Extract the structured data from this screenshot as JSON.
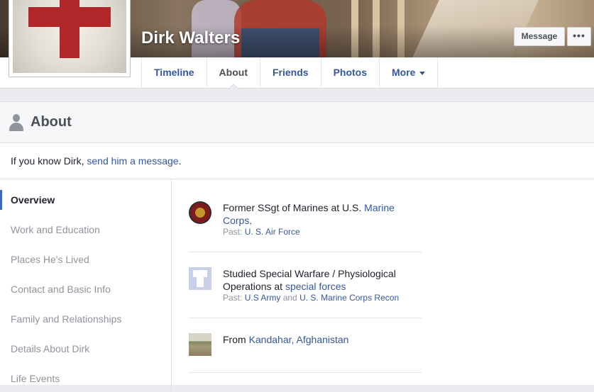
{
  "profile": {
    "name": "Dirk Walters"
  },
  "actions": {
    "message_label": "Message",
    "more_label": "•••"
  },
  "tabs": [
    {
      "label": "Timeline"
    },
    {
      "label": "About"
    },
    {
      "label": "Friends"
    },
    {
      "label": "Photos"
    },
    {
      "label": "More"
    }
  ],
  "about": {
    "title": "About",
    "intro_prefix": "If you know Dirk, ",
    "intro_link": "send him a message",
    "intro_suffix": "."
  },
  "sidenav": [
    {
      "label": "Overview"
    },
    {
      "label": "Work and Education"
    },
    {
      "label": "Places He's Lived"
    },
    {
      "label": "Contact and Basic Info"
    },
    {
      "label": "Family and Relationships"
    },
    {
      "label": "Details About Dirk"
    },
    {
      "label": "Life Events"
    }
  ],
  "entries": {
    "work": {
      "text_prefix": "Former SSgt of Marines at U.S. ",
      "link": "Marine Corps",
      "text_suffix": ".",
      "past_prefix": "Past: ",
      "past_link": "U. S. Air Force"
    },
    "education": {
      "text_prefix": "Studied Special Warfare / Physiological Operations at ",
      "link": "special forces",
      "past_prefix": "Past: ",
      "past_link1": "U.S Army",
      "past_and": " and ",
      "past_link2": "U. S. Marine Corps Recon"
    },
    "hometown": {
      "text_prefix": "From ",
      "link": "Kandahar, Afghanistan"
    }
  },
  "colors": {
    "link": "#365899",
    "accent": "#4267b2",
    "muted": "#90949c",
    "background": "#e9ebee"
  }
}
